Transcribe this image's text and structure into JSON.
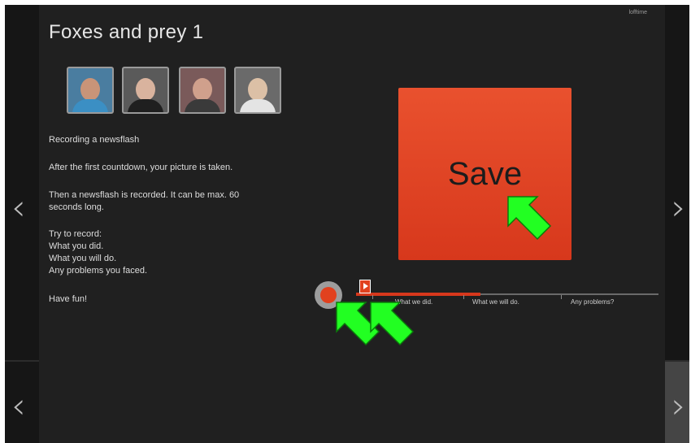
{
  "header": {
    "title": "Foxes and prey 1",
    "corner_label": "lofftime"
  },
  "participants": [
    {
      "name": "participant-1",
      "skin": "#c99478",
      "shirt": "#3b8fc4"
    },
    {
      "name": "participant-2",
      "skin": "#d9b39e",
      "shirt": "#1f1f1f"
    },
    {
      "name": "participant-3",
      "skin": "#d0a08c",
      "shirt": "#3a3a3a"
    },
    {
      "name": "participant-4",
      "skin": "#dcc0a6",
      "shirt": "#e4e4e4"
    }
  ],
  "instructions": {
    "heading": "Recording a newsflash",
    "line1": "After the first countdown, your picture is taken.",
    "line2a": "Then a newsflash is recorded. It can be max. 60",
    "line2b": "seconds long.",
    "line3a": "Try to record:",
    "line3b": "What you did.",
    "line3c": "What you will do.",
    "line3d": "Any problems you faced.",
    "closing": "Have fun!"
  },
  "save_button": {
    "label": "Save",
    "color": "#e1411f"
  },
  "timeline": {
    "progress_fraction": 0.41,
    "segments": [
      "What we did.",
      "What we will do.",
      "Any problems?"
    ]
  },
  "icons": {
    "prev": "chevron-left-icon",
    "next": "chevron-right-icon",
    "cursor": "arrow-cursor-icon"
  },
  "colors": {
    "background": "#202020",
    "accent": "#e1411f",
    "cursor": "#22ff22"
  }
}
